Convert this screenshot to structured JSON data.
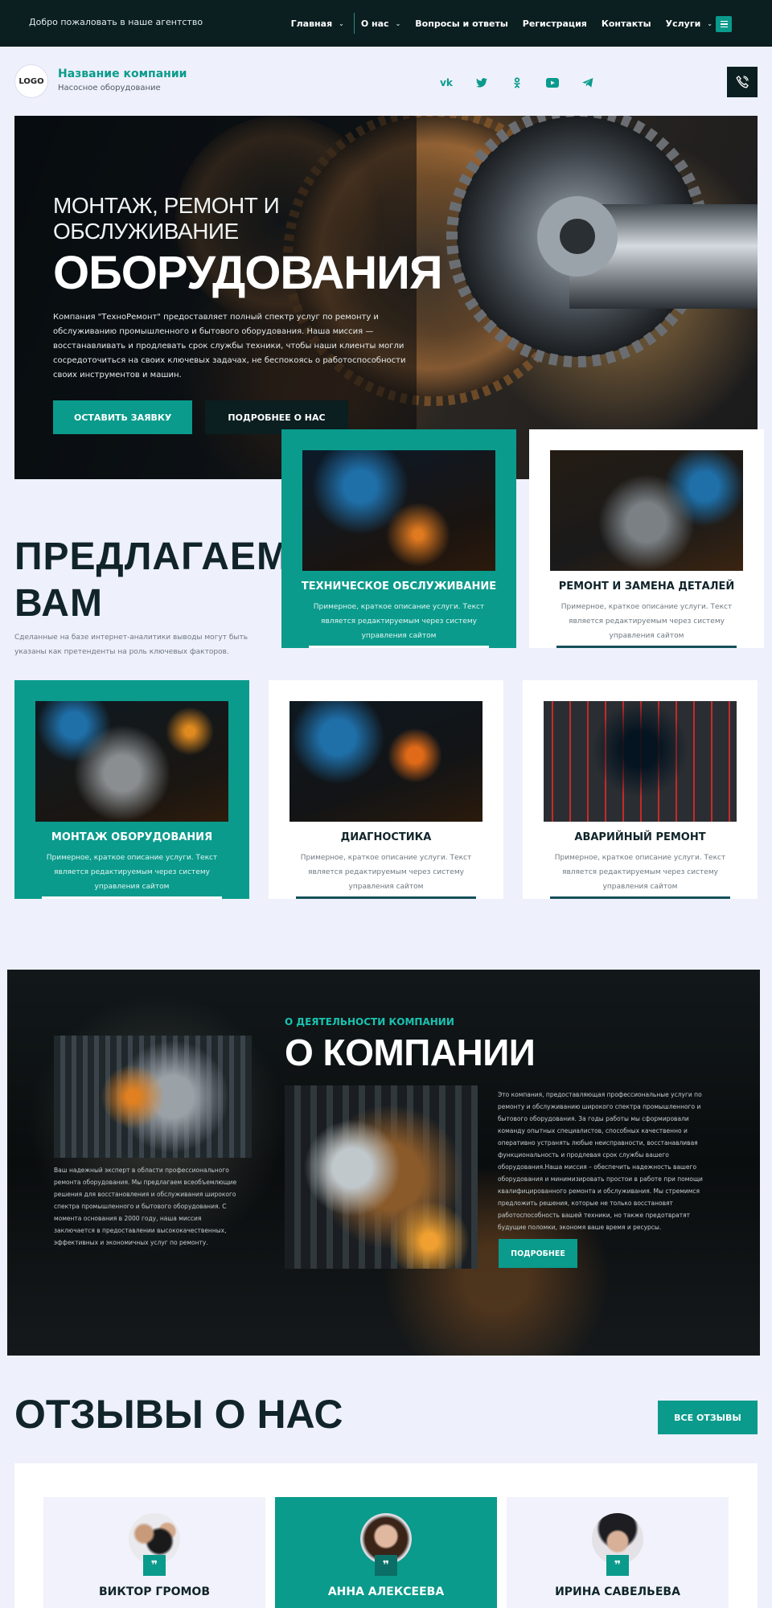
{
  "topbar": {
    "welcome": "Добро пожаловать в наше агентство",
    "nav": [
      {
        "label": "Главная",
        "chevron": true
      },
      {
        "label": "О нас",
        "chevron": true
      },
      {
        "label": "Вопросы и ответы",
        "chevron": false
      },
      {
        "label": "Регистрация",
        "chevron": false
      },
      {
        "label": "Контакты",
        "chevron": false
      },
      {
        "label": "Услуги",
        "chevron": true
      }
    ]
  },
  "header": {
    "logo": "LOGO",
    "company_name": "Название компании",
    "company_sub": "Насосное оборудование",
    "socials": [
      "vk-icon",
      "twitter-icon",
      "odnoklassniki-icon",
      "youtube-icon",
      "telegram-icon"
    ],
    "phone_icon": "phone-icon"
  },
  "hero": {
    "pre": "МОНТАЖ, РЕМОНТ И ОБСЛУЖИВАНИЕ",
    "title": "ОБОРУДОВАНИЯ",
    "text": "Компания \"ТехноРемонт\" предоставляет полный спектр услуг по ремонту и обслуживанию промышленного и бытового оборудования. Наша миссия — восстанавливать и продлевать срок службы техники, чтобы наши клиенты могли сосредоточиться на своих ключевых задачах, не беспокоясь о работоспособности своих инструментов и машин.",
    "btn_primary": "ОСТАВИТЬ ЗАЯВКУ",
    "btn_secondary": "ПОДРОБНЕЕ О НАС"
  },
  "offer": {
    "title_line1": "ПРЕДЛАГАЕМ",
    "title_line2": "ВАМ",
    "text": "Сделанные на базе интернет-аналитики выводы могут быть указаны как претенденты на роль ключевых факторов."
  },
  "services": [
    {
      "title": "ТЕХНИЧЕСКОЕ ОБСЛУЖИВАНИЕ",
      "desc": "Примерное, краткое описание услуги. Текст является редактируемым через систему управления сайтом"
    },
    {
      "title": "РЕМОНТ И ЗАМЕНА ДЕТАЛЕЙ",
      "desc": "Примерное, краткое описание услуги. Текст является редактируемым через систему управления сайтом"
    },
    {
      "title": "МОНТАЖ ОБОРУДОВАНИЯ",
      "desc": "Примерное, краткое описание услуги. Текст является редактируемым через систему управления сайтом"
    },
    {
      "title": "ДИАГНОСТИКА",
      "desc": "Примерное, краткое описание услуги. Текст является редактируемым через систему управления сайтом"
    },
    {
      "title": "АВАРИЙНЫЙ РЕМОНТ",
      "desc": "Примерное, краткое описание услуги. Текст является редактируемым через систему управления сайтом"
    }
  ],
  "about": {
    "subtitle": "О ДЕЯТЕЛЬНОСТИ КОМПАНИИ",
    "title": "О КОМПАНИИ",
    "left_text": "Ваш надежный эксперт в области профессионального ремонта оборудования. Мы предлагаем всеобъемлющие решения для восстановления и обслуживания широкого спектра промышленного и бытового оборудования. С момента основания в 2000 году, наша миссия заключается в предоставлении высококачественных, эффективных и экономичных услуг по ремонту.",
    "right_text": "Это компания, предоставляющая профессиональные услуги по ремонту и обслуживанию широкого спектра промышленного и бытового оборудования. За годы работы мы сформировали команду опытных специалистов, способных качественно и оперативно устранять любые неисправности, восстанавливая функциональность и продлевая срок службы вашего оборудования.Наша миссия – обеспечить надежность вашего оборудования и минимизировать простои в работе при помощи квалифицированного ремонта и обслуживания. Мы стремимся предложить решения, которые не только восстановят работоспособность вашей техники, но также предотвратят будущие поломки, экономя ваше время и ресурсы.",
    "btn": "ПОДРОБНЕЕ"
  },
  "reviews": {
    "title": "ОТЗЫВЫ О НАС",
    "all_btn": "ВСЕ  ОТЗЫВЫ",
    "people": [
      {
        "name": "ВИКТОР ГРОМОВ"
      },
      {
        "name": "АННА АЛЕКСЕЕВА"
      },
      {
        "name": "ИРИНА САВЕЛЬЕВА"
      }
    ],
    "quote_icon": "quote-icon"
  }
}
